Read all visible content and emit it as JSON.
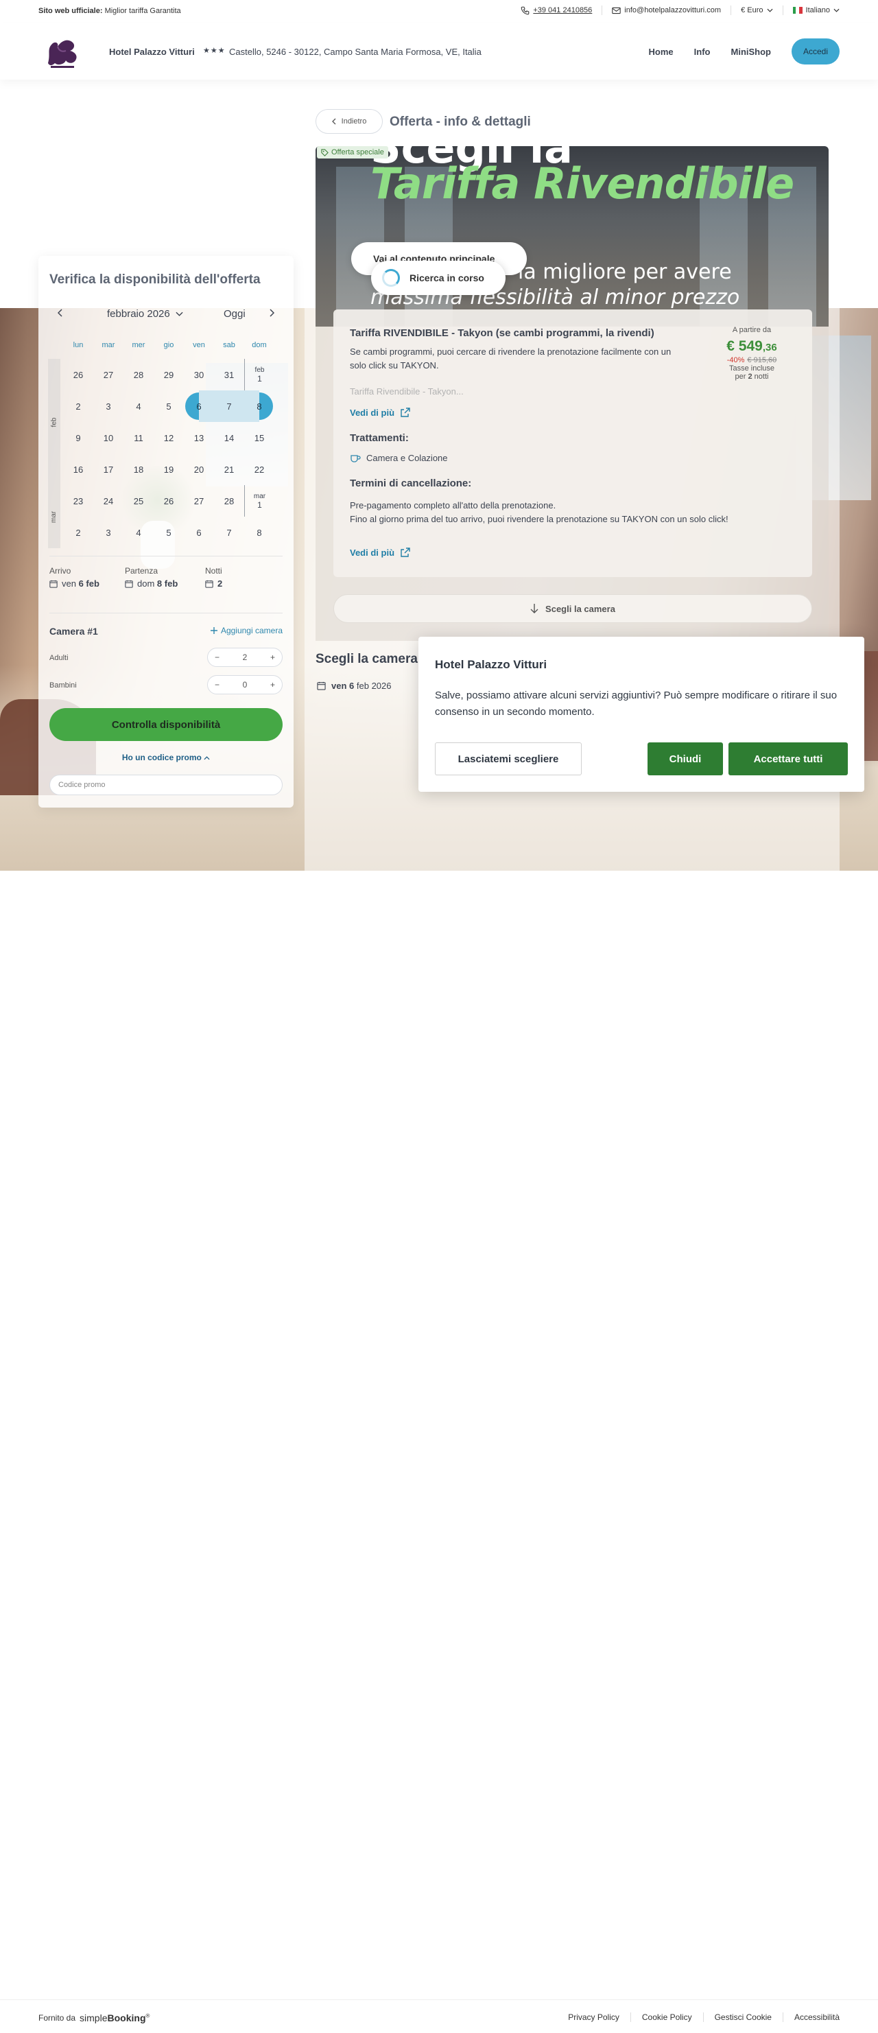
{
  "topbar": {
    "official_label": "Sito web ufficiale:",
    "official_text": "Miglior tariffa Garantita",
    "phone": "+39 041 2410856",
    "email": "info@hotelpalazzovitturi.com",
    "currency": "€ Euro",
    "language": "Italiano"
  },
  "header": {
    "hotel_name": "Hotel Palazzo Vitturi",
    "stars": "★★★",
    "address": "Castello, 5246 - 30122, Campo Santa Maria Formosa, VE, Italia",
    "nav": [
      "Home",
      "Info",
      "MiniShop"
    ],
    "login": "Accedi"
  },
  "page": {
    "back": "Indietro",
    "title": "Offerta - info & dettagli"
  },
  "banner": {
    "tag": "Offerta speciale",
    "line0": "Scegli la",
    "line1": "Tariffa Rivendibile",
    "line2": "la migliore per avere",
    "line3": "massima flessibilità al minor prezzo",
    "info_pill": "Vai al contenuto principale",
    "loading": "Ricerca in corso"
  },
  "offer": {
    "title": "Tariffa RIVENDIBILE - Takyon (se cambi programmi, la rivendi)",
    "desc": "Se cambi programmi, puoi cercare di rivendere la prenotazione facilmente con un solo click su TAKYON.",
    "fade": "Tariffa Rivendibile - Takyon...",
    "more1": "Vedi di più",
    "treatments_h": "Trattamenti:",
    "treatment": "Camera e Colazione",
    "cancel_h": "Termini di cancellazione:",
    "cancel_1": "Pre-pagamento completo all'atto della prenotazione.",
    "cancel_2": "Fino al giorno prima del tuo arrivo, puoi rivendere la prenotazione su TAKYON con un solo click!",
    "more2": "Vedi di più",
    "from": "A partire da",
    "price_main": "€ 549",
    "price_dec": ",36",
    "discount": "-40%",
    "old_price": "€ 915,60",
    "taxes": "Tasse incluse",
    "per": "per",
    "nights_num": "2",
    "nights": "notti",
    "choose_room": "Scegli la camera"
  },
  "rooms": {
    "title": "Scegli la camera",
    "date_day": "ven",
    "date_num": "6",
    "date_rest": "feb 2026"
  },
  "availability": {
    "title": "Verifica la disponibilità dell'offerta",
    "month": "febbraio 2026",
    "today": "Oggi",
    "dows": [
      "lun",
      "mar",
      "mer",
      "gio",
      "ven",
      "sab",
      "dom"
    ],
    "side_feb": "feb",
    "side_mar": "mar",
    "weeks": [
      [
        "26",
        "27",
        "28",
        "29",
        "30",
        "31",
        "1"
      ],
      [
        "2",
        "3",
        "4",
        "5",
        "6",
        "7",
        "8"
      ],
      [
        "9",
        "10",
        "11",
        "12",
        "13",
        "14",
        "15"
      ],
      [
        "16",
        "17",
        "18",
        "19",
        "20",
        "21",
        "22"
      ],
      [
        "23",
        "24",
        "25",
        "26",
        "27",
        "28",
        "1"
      ],
      [
        "2",
        "3",
        "4",
        "5",
        "6",
        "7",
        "8"
      ]
    ],
    "mark_feb": "feb",
    "mark_mar": "mar",
    "arrival_label": "Arrivo",
    "arrival_day": "ven",
    "arrival_date": "6 feb",
    "departure_label": "Partenza",
    "departure_day": "dom",
    "departure_date": "8 feb",
    "nights_label": "Notti",
    "nights": "2",
    "room_label": "Camera #1",
    "add_room": "Aggiungi camera",
    "adults_label": "Adulti",
    "adults": "2",
    "children_label": "Bambini",
    "children": "0",
    "check": "Controlla disponibilità",
    "promo_link": "Ho un codice promo",
    "promo_placeholder": "Codice promo"
  },
  "cookie": {
    "title": "Hotel Palazzo Vitturi",
    "text": "Salve, possiamo attivare alcuni servizi aggiuntivi? Può sempre modificare o ritirare il suo consenso in un secondo momento.",
    "choose": "Lasciatemi scegliere",
    "close": "Chiudi",
    "accept": "Accettare tutti"
  },
  "footer": {
    "powered": "Fornito da",
    "brand_a": "simple",
    "brand_b": "Booking",
    "brand_sup": "®",
    "links": [
      "Privacy Policy",
      "Cookie Policy",
      "Gestisci Cookie",
      "Accessibilità"
    ]
  },
  "colors": {
    "accent": "#3da8d1",
    "green": "#45a845",
    "dark_green": "#2e7d32",
    "price_green": "#3d8f3a",
    "discount_red": "#d0352c"
  }
}
